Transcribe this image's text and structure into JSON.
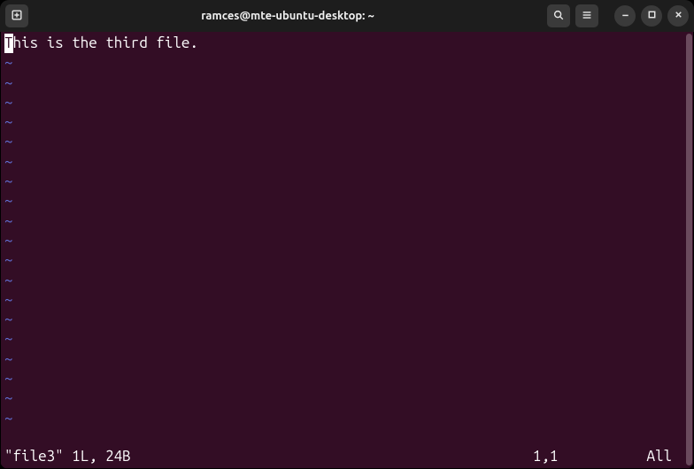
{
  "titlebar": {
    "title": "ramces@mte-ubuntu-desktop: ~"
  },
  "editor": {
    "cursor_char": "T",
    "line_rest": "his is the third file.",
    "tilde": "~"
  },
  "status": {
    "file_info": "\"file3\" 1L, 24B",
    "position": "1,1",
    "view": "All"
  }
}
